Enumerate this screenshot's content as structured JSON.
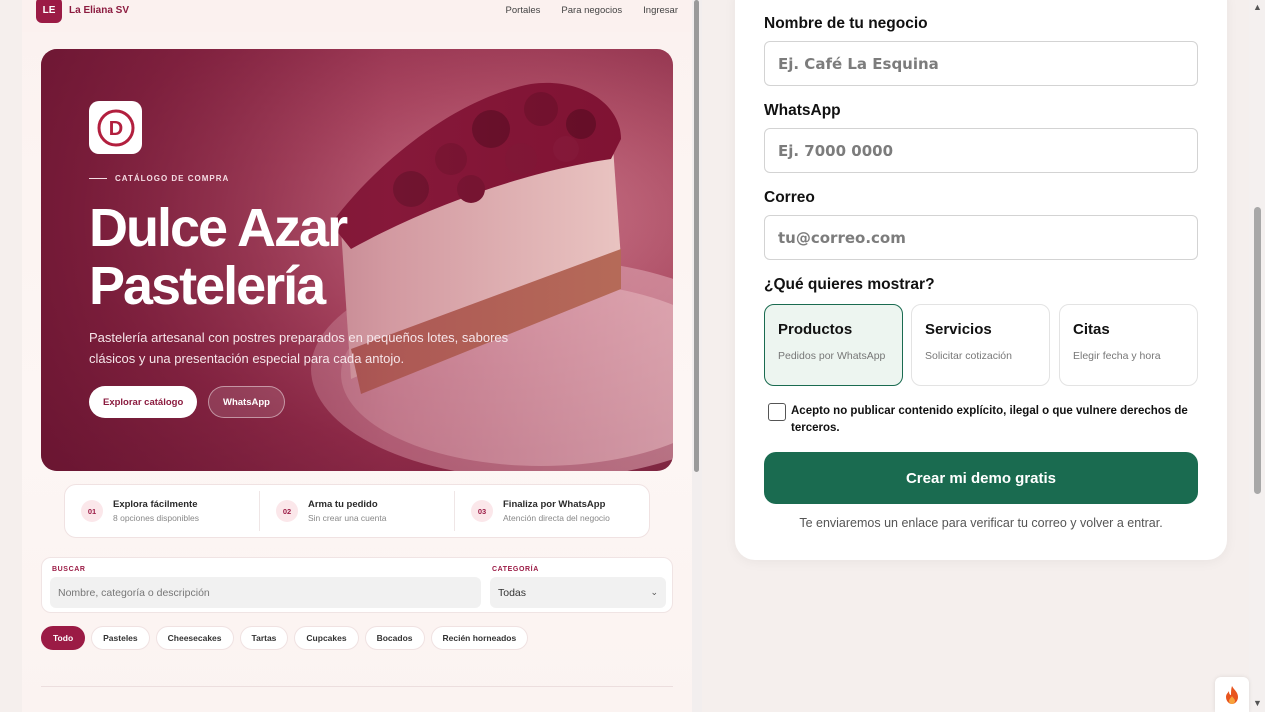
{
  "preview": {
    "brand_initials": "LE",
    "brand_name": "La Eliana SV",
    "nav": [
      "Portales",
      "Para negocios",
      "Ingresar"
    ],
    "hero": {
      "logo_letter": "D",
      "eyebrow": "CATÁLOGO DE COMPRA",
      "title_line1": "Dulce Azar",
      "title_line2": "Pastelería",
      "description": "Pastelería artesanal con postres preparados en pequeños lotes, sabores clásicos y una presentación especial para cada antojo.",
      "primary_button": "Explorar catálogo",
      "secondary_button": "WhatsApp"
    },
    "steps": [
      {
        "num": "01",
        "title": "Explora fácilmente",
        "sub": "8 opciones disponibles"
      },
      {
        "num": "02",
        "title": "Arma tu pedido",
        "sub": "Sin crear una cuenta"
      },
      {
        "num": "03",
        "title": "Finaliza por WhatsApp",
        "sub": "Atención directa del negocio"
      }
    ],
    "search": {
      "label": "BUSCAR",
      "placeholder": "Nombre, categoría o descripción",
      "category_label": "CATEGORÍA",
      "category_value": "Todas"
    },
    "chips": [
      "Todo",
      "Pasteles",
      "Cheesecakes",
      "Tartas",
      "Cupcakes",
      "Bocados",
      "Recién horneados"
    ]
  },
  "form": {
    "business_label": "Nombre de tu negocio",
    "business_placeholder": "Ej. Café La Esquina",
    "whatsapp_label": "WhatsApp",
    "whatsapp_placeholder": "Ej. 7000 0000",
    "email_label": "Correo",
    "email_placeholder": "tu@correo.com",
    "show_label": "¿Qué quieres mostrar?",
    "options": [
      {
        "title": "Productos",
        "sub": "Pedidos por WhatsApp",
        "selected": true
      },
      {
        "title": "Servicios",
        "sub": "Solicitar cotización",
        "selected": false
      },
      {
        "title": "Citas",
        "sub": "Elegir fecha y hora",
        "selected": false
      }
    ],
    "terms": "Acepto no publicar contenido explícito, ilegal o que vulnere derechos de terceros.",
    "submit": "Crear mi demo gratis",
    "hint": "Te enviaremos un enlace para verificar tu correo y volver a entrar."
  },
  "colors": {
    "brand": "#9b1b45",
    "accent_green": "#1a6b50"
  }
}
